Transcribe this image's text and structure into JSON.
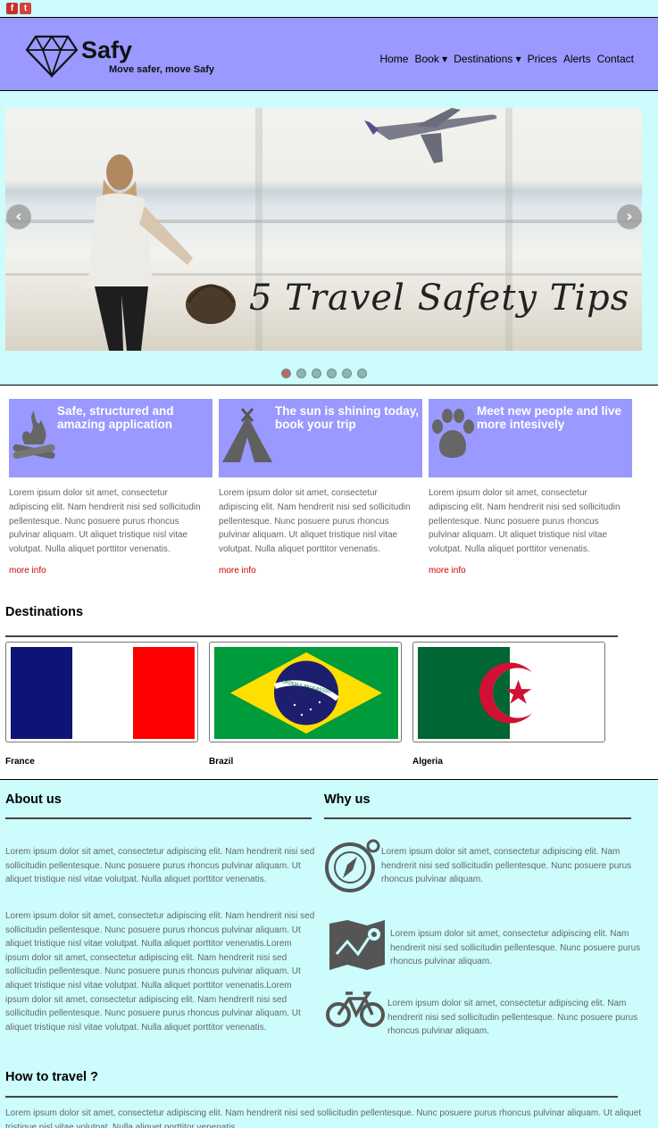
{
  "social": {
    "facebook": "f",
    "twitter": "t"
  },
  "header": {
    "brand": "Safy",
    "tagline": "Move safer, move Safy",
    "logo_icon": "diamond-icon",
    "nav": [
      "Home",
      "Book ▾",
      "Destinations ▾",
      "Prices",
      "Alerts",
      "Contact"
    ]
  },
  "slider": {
    "caption": "5 Travel Safety Tips",
    "prev": "‹",
    "next": "›",
    "slide_count": 6,
    "active_index": 0
  },
  "features": [
    {
      "title": "Safe, structured and amazing application",
      "icon": "campfire-icon",
      "text": "Lorem ipsum dolor sit amet, consectetur adipiscing elit. Nam hendrerit nisi sed sollicitudin pellentesque. Nunc posuere purus rhoncus pulvinar aliquam. Ut aliquet tristique nisl vitae volutpat. Nulla aliquet porttitor venenatis.",
      "more": "more info"
    },
    {
      "title": "The sun is shining today, book your trip",
      "icon": "tent-icon",
      "text": "Lorem ipsum dolor sit amet, consectetur adipiscing elit. Nam hendrerit nisi sed sollicitudin pellentesque. Nunc posuere purus rhoncus pulvinar aliquam. Ut aliquet tristique nisl vitae volutpat. Nulla aliquet porttitor venenatis.",
      "more": "more info"
    },
    {
      "title": "Meet new people and live more intesively",
      "icon": "paw-icon",
      "text": "Lorem ipsum dolor sit amet, consectetur adipiscing elit. Nam hendrerit nisi sed sollicitudin pellentesque. Nunc posuere purus rhoncus pulvinar aliquam. Ut aliquet tristique nisl vitae volutpat. Nulla aliquet porttitor venenatis.",
      "more": "more info"
    }
  ],
  "destinations": {
    "title": "Destinations",
    "items": [
      {
        "name": "France"
      },
      {
        "name": "Brazil",
        "flag_text": "ORDEM E PROGRESSO"
      },
      {
        "name": "Algeria"
      }
    ]
  },
  "about": {
    "title": "About us",
    "p1": "Lorem ipsum dolor sit amet, consectetur adipiscing elit. Nam hendrerit nisi sed sollicitudin pellentesque. Nunc posuere purus rhoncus pulvinar aliquam. Ut aliquet tristique nisl vitae volutpat. Nulla aliquet porttitor venenatis.",
    "p2": "Lorem ipsum dolor sit amet, consectetur adipiscing elit. Nam hendrerit nisi sed sollicitudin pellentesque. Nunc posuere purus rhoncus pulvinar aliquam. Ut aliquet tristique nisl vitae volutpat. Nulla aliquet porttitor venenatis.Lorem ipsum dolor sit amet, consectetur adipiscing elit. Nam hendrerit nisi sed sollicitudin pellentesque. Nunc posuere purus rhoncus pulvinar aliquam. Ut aliquet tristique nisl vitae volutpat. Nulla aliquet porttitor venenatis.Lorem ipsum dolor sit amet, consectetur adipiscing elit. Nam hendrerit nisi sed sollicitudin pellentesque. Nunc posuere purus rhoncus pulvinar aliquam. Ut aliquet tristique nisl vitae volutpat. Nulla aliquet porttitor venenatis."
  },
  "why": {
    "title": "Why us",
    "items": [
      {
        "icon": "compass-icon",
        "text": "Lorem ipsum dolor sit amet, consectetur adipiscing elit. Nam hendrerit nisi sed sollicitudin pellentesque. Nunc posuere purus rhoncus pulvinar aliquam."
      },
      {
        "icon": "map-icon",
        "text": "Lorem ipsum dolor sit amet, consectetur adipiscing elit. Nam hendrerit nisi sed sollicitudin pellentesque. Nunc posuere purus rhoncus pulvinar aliquam."
      },
      {
        "icon": "bicycle-icon",
        "text": "Lorem ipsum dolor sit amet, consectetur adipiscing elit. Nam hendrerit nisi sed sollicitudin pellentesque. Nunc posuere purus rhoncus pulvinar aliquam."
      }
    ]
  },
  "how": {
    "title": "How to travel ?",
    "text": "Lorem ipsum dolor sit amet, consectetur adipiscing elit. Nam hendrerit nisi sed sollicitudin pellentesque. Nunc posuere purus rhoncus pulvinar aliquam. Ut aliquet tristique nisl vitae volutpat. Nulla aliquet porttitor venenatis."
  },
  "colors": {
    "header_bg": "#9999ff",
    "section_bg": "#ccfcfc",
    "link": "#cc0000"
  }
}
